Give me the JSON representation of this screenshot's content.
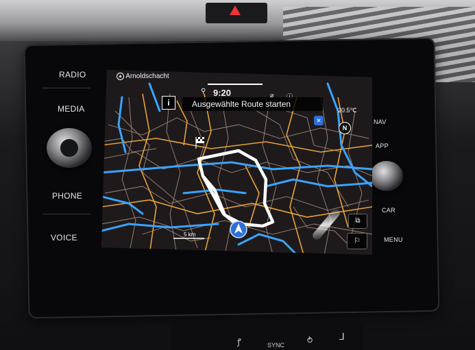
{
  "hardware": {
    "radio_label": "RADIO",
    "media_label": "MEDIA",
    "phone_label": "PHONE",
    "voice_label": "VOICE",
    "nav_label": "NAV",
    "app_label": "APP",
    "car_label": "CAR",
    "menu_label": "MENU",
    "sync_label": "SYNC"
  },
  "screen": {
    "location_name": "Arnoldschacht",
    "clock": "9:20",
    "info_icon": "info-icon",
    "route_banner": "Ausgewählte Route starten",
    "temperature": "20.5℃",
    "compass": "N",
    "scale_label": "5 km"
  },
  "colors": {
    "major_roads": "#3aa4ff",
    "secondary_roads": "#e8a33a",
    "minor_roads": "#c8b09a",
    "route": "#ffffff",
    "map_background": "#1e1a1c",
    "hazard_red": "#e33333"
  }
}
